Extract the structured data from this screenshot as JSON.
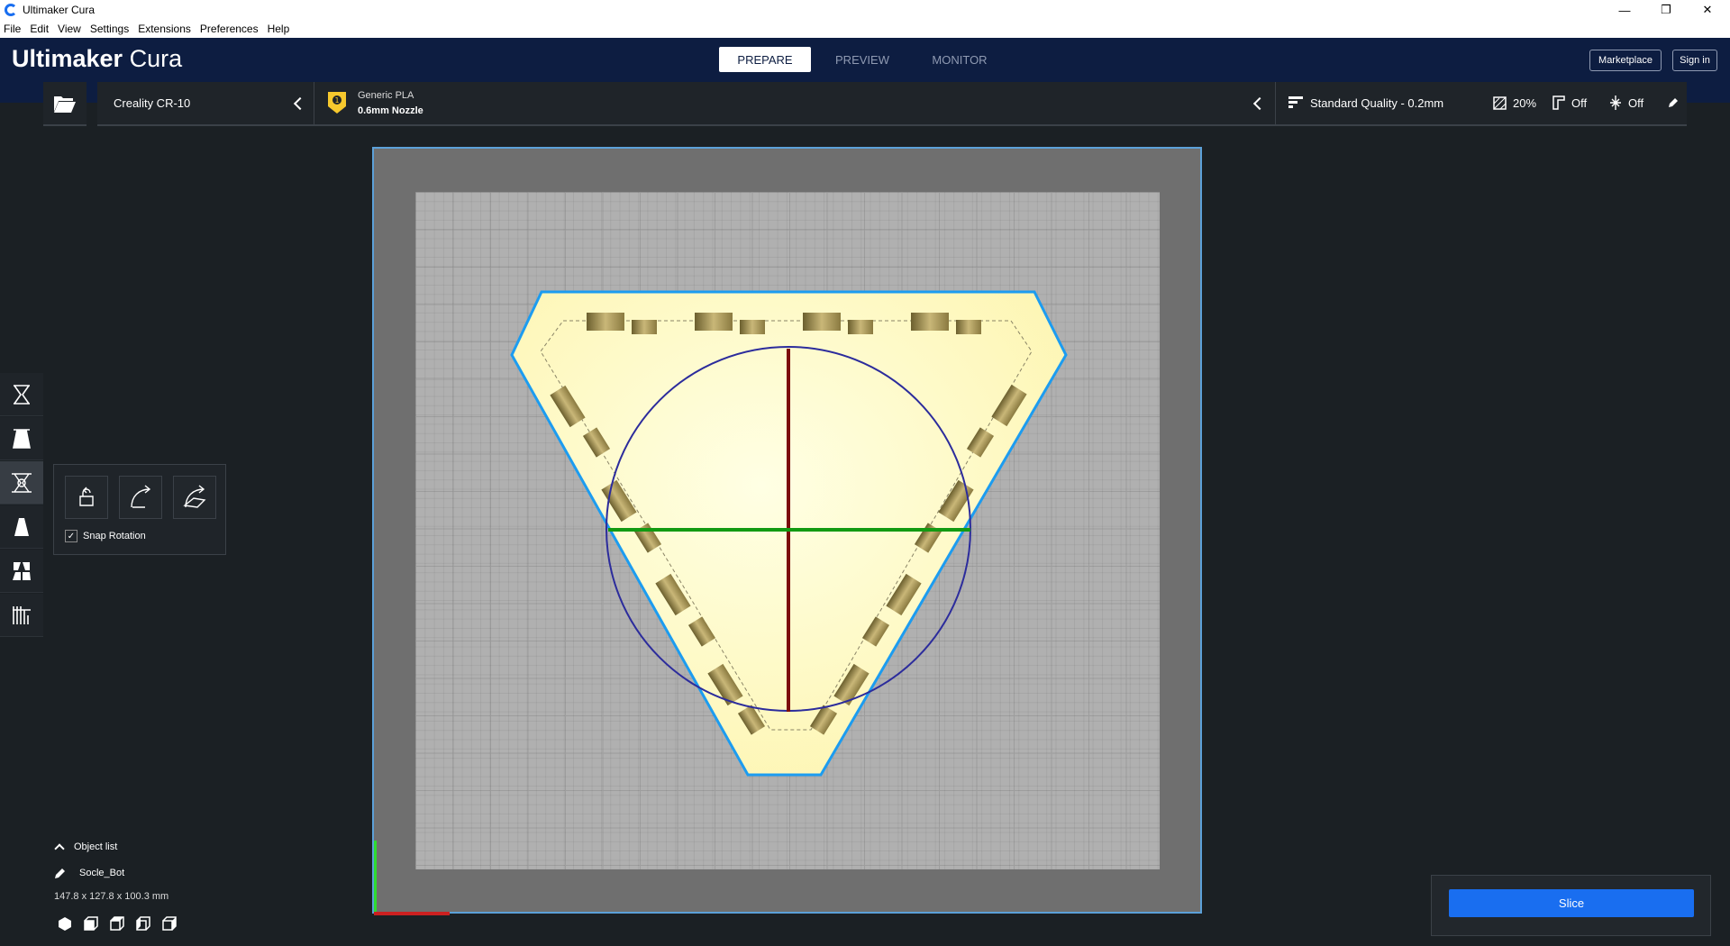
{
  "window": {
    "title": "Ultimaker Cura"
  },
  "menu": [
    "File",
    "Edit",
    "View",
    "Settings",
    "Extensions",
    "Preferences",
    "Help"
  ],
  "header": {
    "logo_main": "Ultimaker",
    "logo_sub": "Cura",
    "tabs": [
      "PREPARE",
      "PREVIEW",
      "MONITOR"
    ],
    "active_tab": "PREPARE",
    "marketplace": "Marketplace",
    "signin": "Sign in"
  },
  "stage": {
    "printer": "Creality CR-10",
    "material": "Generic PLA",
    "nozzle": "0.6mm Nozzle",
    "quality": "Standard Quality - 0.2mm",
    "infill": "20%",
    "support": "Off",
    "adhesion": "Off"
  },
  "rotate": {
    "snap_label": "Snap Rotation",
    "snap_checked": true
  },
  "object_list": {
    "label": "Object list",
    "object_name": "Socle_Bot",
    "dimensions": "147.8 x 127.8 x 100.3 mm"
  },
  "slice": {
    "label": "Slice"
  },
  "colors": {
    "accent": "#196ef0",
    "header": "#0d1d41",
    "model": "#ffffc8",
    "outline": "#1c9cf0"
  }
}
